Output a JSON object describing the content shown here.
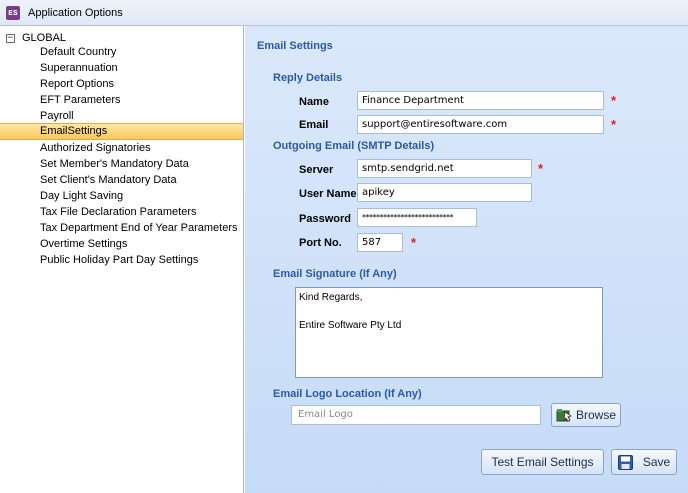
{
  "window": {
    "title": "Application Options",
    "icon": "app-logo-icon"
  },
  "tree": {
    "root_label": "GLOBAL",
    "expander": "⊟",
    "items": [
      {
        "label": "Default Country",
        "selected": false
      },
      {
        "label": "Superannuation",
        "selected": false
      },
      {
        "label": "Report Options",
        "selected": false
      },
      {
        "label": "EFT Parameters",
        "selected": false
      },
      {
        "label": "Payroll",
        "selected": false
      },
      {
        "label": "EmailSettings",
        "selected": true
      },
      {
        "label": "Authorized Signatories",
        "selected": false
      },
      {
        "label": "Set Member's Mandatory Data",
        "selected": false
      },
      {
        "label": "Set Client's Mandatory Data",
        "selected": false
      },
      {
        "label": "Day Light Saving",
        "selected": false
      },
      {
        "label": "Tax File Declaration Parameters",
        "selected": false
      },
      {
        "label": "Tax Department End of Year Parameters",
        "selected": false
      },
      {
        "label": "Overtime Settings",
        "selected": false
      },
      {
        "label": "Public Holiday Part Day Settings",
        "selected": false
      }
    ]
  },
  "panel": {
    "title": "Email Settings",
    "reply": {
      "heading": "Reply Details",
      "name_label": "Name",
      "name_value": "Finance Department",
      "email_label": "Email",
      "email_value": "support@entiresoftware.com"
    },
    "outgoing": {
      "heading": "Outgoing Email (SMTP Details)",
      "server_label": "Server",
      "server_value": "smtp.sendgrid.net",
      "username_label": "User Name",
      "username_value": "apikey",
      "password_label": "Password",
      "password_value": "**************************",
      "port_label": "Port No.",
      "port_value": "587"
    },
    "required_marker": "*",
    "signature": {
      "heading": "Email Signature (If Any)",
      "line1": "Kind Regards,",
      "line2": "Entire Software Pty Ltd"
    },
    "logo": {
      "heading": "Email Logo Location (If Any)",
      "placeholder": "Email Logo",
      "browse_label": "Browse"
    },
    "buttons": {
      "test_label": "Test Email Settings",
      "save_label": "Save"
    }
  },
  "colors": {
    "section_heading": "#2a5aa6",
    "required": "#e02020",
    "selected_item": "#f8c85c",
    "panel_bg": "#d3e3f9"
  }
}
